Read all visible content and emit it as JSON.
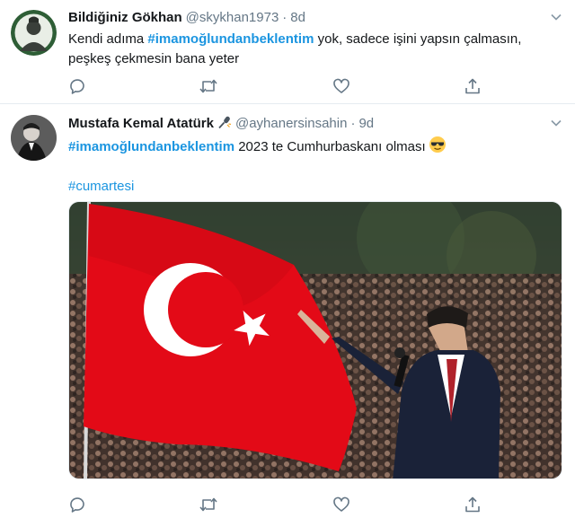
{
  "tweets": [
    {
      "name": "Bildiğiniz Gökhan",
      "handle": "@skykhan1973",
      "separator": "·",
      "time": "8d",
      "text_before": "Kendi adıma ",
      "hashtag": "#imamoğlundanbeklentim",
      "text_after": " yok, sadece işini yapsın çalmasın, peşkeş çekmesin bana yeter",
      "avatar_icon": "ataturk-portrait-avatar",
      "actions": [
        "reply-icon",
        "retweet-icon",
        "like-icon",
        "share-icon"
      ]
    },
    {
      "name": "Mustafa Kemal Atatürk",
      "name_icon": "microphone-icon",
      "handle": "@ayhanersinsahin",
      "separator": "·",
      "time": "9d",
      "hashtag": "#imamoğlundanbeklentim",
      "text_after": " 2023 te Cumhurbaskanı olması",
      "emoji_icon": "sunglasses-emoji-icon",
      "second_hashtag": "#cumartesi",
      "avatar_icon": "ataturk-photo-avatar",
      "media": "turkish-flag-rally-photo",
      "actions": [
        "reply-icon",
        "retweet-icon",
        "like-icon",
        "share-icon"
      ]
    }
  ],
  "colors": {
    "hashtag": "#1b95e0",
    "secondary_text": "#657786",
    "flag_red": "#e30a17",
    "border": "#e6ecf0"
  }
}
